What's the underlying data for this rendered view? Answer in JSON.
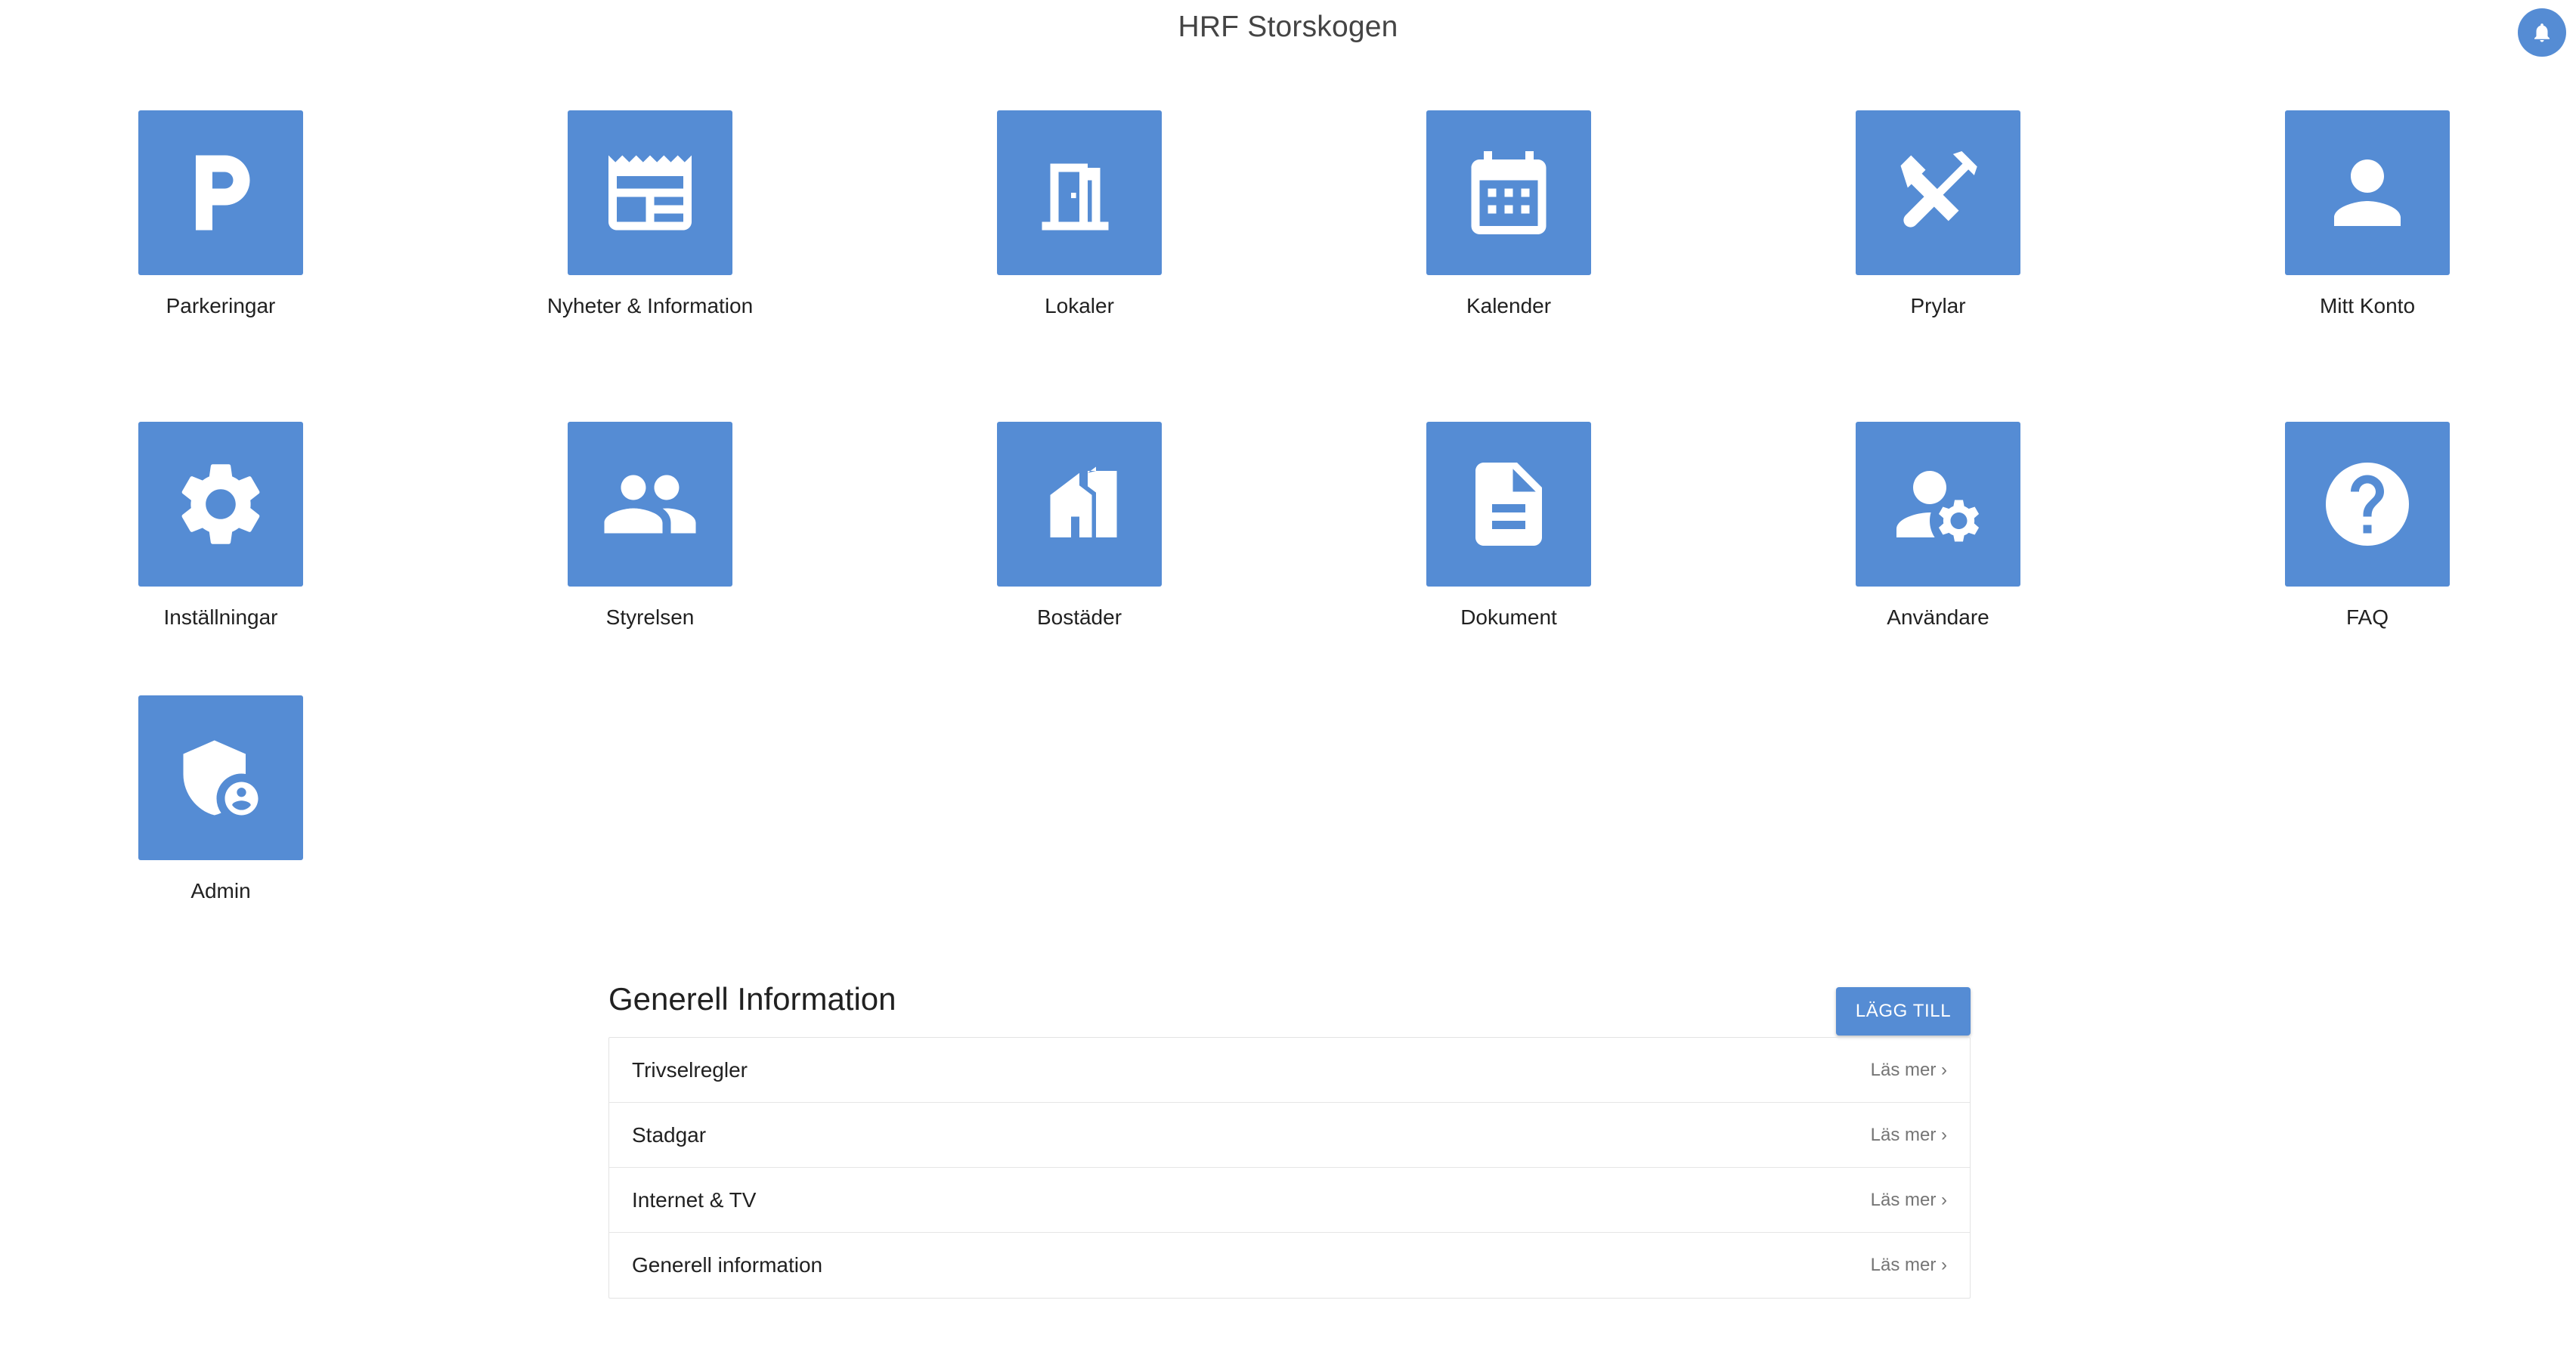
{
  "header": {
    "title": "HRF Storskogen",
    "bell_icon": "bell-icon"
  },
  "colors": {
    "accent": "#558cd4"
  },
  "tiles": [
    {
      "label": "Parkeringar",
      "icon": "parking-icon"
    },
    {
      "label": "Nyheter & Information",
      "icon": "newspaper-icon"
    },
    {
      "label": "Lokaler",
      "icon": "door-icon"
    },
    {
      "label": "Kalender",
      "icon": "calendar-icon"
    },
    {
      "label": "Prylar",
      "icon": "tools-icon"
    },
    {
      "label": "Mitt Konto",
      "icon": "person-icon"
    },
    {
      "label": "Inställningar",
      "icon": "gear-icon"
    },
    {
      "label": "Styrelsen",
      "icon": "people-icon"
    },
    {
      "label": "Bostäder",
      "icon": "house-icon"
    },
    {
      "label": "Dokument",
      "icon": "document-icon"
    },
    {
      "label": "Användare",
      "icon": "user-settings-icon"
    },
    {
      "label": "FAQ",
      "icon": "question-icon"
    },
    {
      "label": "Admin",
      "icon": "admin-shield-icon"
    }
  ],
  "info": {
    "title": "Generell Information",
    "add_label": "LÄGG TILL",
    "items": [
      {
        "title": "Trivselregler",
        "link": "Läs mer ›"
      },
      {
        "title": "Stadgar",
        "link": "Läs mer ›"
      },
      {
        "title": "Internet & TV",
        "link": "Läs mer ›"
      },
      {
        "title": "Generell information",
        "link": "Läs mer ›"
      }
    ]
  }
}
